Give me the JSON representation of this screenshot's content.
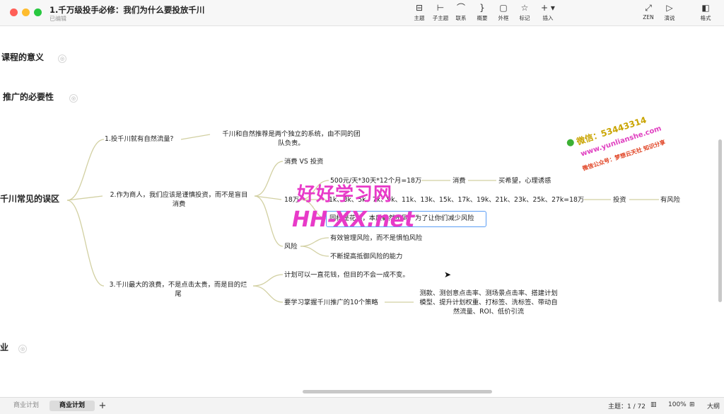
{
  "window": {
    "title": "1.千万级投手必修：我们为什么要投放千川",
    "subtitle": "已编辑",
    "traffic_colors": [
      "#ff5f57",
      "#febc2e",
      "#28c840"
    ]
  },
  "toolbar": {
    "items": [
      {
        "label": "主题",
        "icon": "topic-icon",
        "glyph": "⊟"
      },
      {
        "label": "子主题",
        "icon": "subtopic-icon",
        "glyph": "⊢"
      },
      {
        "label": "联系",
        "icon": "relationship-icon",
        "glyph": "⌒"
      },
      {
        "label": "概要",
        "icon": "summary-icon",
        "glyph": "}"
      },
      {
        "label": "外框",
        "icon": "boundary-icon",
        "glyph": "▢"
      },
      {
        "label": "标记",
        "icon": "marker-icon",
        "glyph": "☆"
      },
      {
        "label": "插入",
        "icon": "insert-icon",
        "glyph": "+ ▾"
      }
    ],
    "right_items": [
      {
        "label": "ZEN",
        "icon": "zen-mode-icon",
        "glyph": "⤢"
      },
      {
        "label": "演说",
        "icon": "pitch-icon",
        "glyph": "▷"
      },
      {
        "label": "格式",
        "icon": "format-panel-icon",
        "glyph": "◧"
      }
    ]
  },
  "mindmap": {
    "left_topics": [
      "课程的意义",
      "推广的必要性",
      "千川常见的误区",
      "业"
    ],
    "b1": "1.投千川就有自然流量?",
    "b1_desc_line1": "千川和自然推荐是两个独立的系统，由不同的团",
    "b1_desc_line2": "队负责。",
    "b2_line1": "2.作为商人，我们应该是谨慎投资，而不是盲目",
    "b2_line2": "消费",
    "b2_c1": "消费 VS 投资",
    "b2_c2": "18万",
    "b2_c2_a": "500元/天*30天*12个月=18万",
    "b2_c2_a_1": "消费",
    "b2_c2_a_2": "买希望，心理诱惑",
    "b2_c2_b": "1k、3k、5k、7k、9k、11k、13k、15k、17k、19k、21k、23k、25k、27k=18万",
    "b2_c2_b_1": "投资",
    "b2_c2_b_2": "有风险",
    "b2_c2_c": "同样是花钱，本质截然不同，为了让你们减少风险",
    "b2_c3": "风险",
    "b2_c3_a": "有效管理风险，而不是惧怕风险",
    "b2_c3_b": "不断提高抵御风险的能力",
    "b3_line1": "3.千川最大的浪费，不是点击太贵，而是目的烂",
    "b3_line2": "尾",
    "b3_c1": "计划可以一直花钱，但目的不会一成不变。",
    "b3_c2": "要学习掌握千川推广的10个策略",
    "b3_c2_line1": "测款、测创意点击率、测场景点击率、搭建计划",
    "b3_c2_line2": "模型、提升计划权重、打标签、洗标签、带动自",
    "b3_c2_line3": "然流量、ROI、低价引流",
    "line_color": "#d2d0a2"
  },
  "watermark": {
    "text1": "好好学习网",
    "text2": "HH-XX.net",
    "stamp_line1": "微信：53443314",
    "stamp_line2": "www.yunlianshe.com",
    "stamp_line3": "微信公众号：梦想云天社 知识分享"
  },
  "bottom": {
    "tabs": [
      "商业计划",
      "商业计划"
    ],
    "add": "+",
    "status": "主题：1 / 72",
    "zoom": "100%",
    "outline": "大纲"
  }
}
